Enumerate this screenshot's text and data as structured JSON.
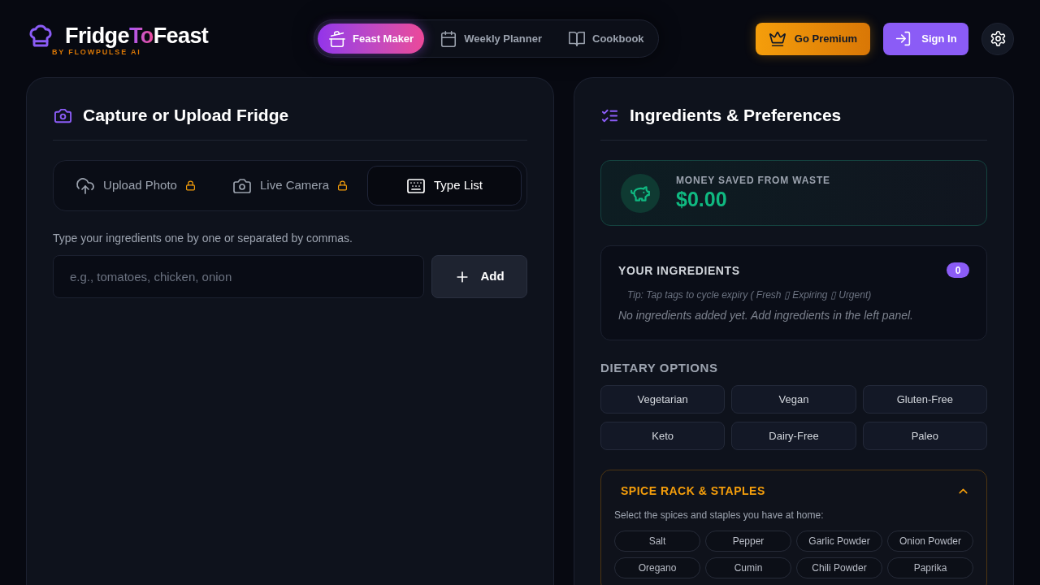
{
  "header": {
    "logo": {
      "title_start": "Fridge",
      "title_accent": "To",
      "title_end": "Feast",
      "tagline": "BY FLOWPULSE AI"
    },
    "nav_tabs": [
      {
        "label": "Feast Maker",
        "selected": true
      },
      {
        "label": "Weekly Planner",
        "selected": false
      },
      {
        "label": "Cookbook",
        "selected": false
      }
    ],
    "actions": [
      {
        "kind": "premium",
        "label": "Go Premium"
      },
      {
        "kind": "signin",
        "label": "Sign In"
      },
      {
        "kind": "settings"
      }
    ]
  },
  "capture_panel": {
    "title": "Capture or Upload Fridge",
    "mode_tabs": [
      {
        "label": "Upload Photo",
        "locked": true,
        "selected": false
      },
      {
        "label": "Live Camera",
        "locked": true,
        "selected": false
      },
      {
        "label": "Type List",
        "locked": false,
        "selected": true
      }
    ],
    "hint": "Type your ingredients one by one or separated by commas.",
    "input": {
      "placeholder": "e.g., tomatoes, chicken, onion"
    },
    "add_button": "Add"
  },
  "preferences_panel": {
    "title": "Ingredients & Preferences",
    "savings": {
      "label": "MONEY SAVED FROM WASTE",
      "amount": "$0.00"
    },
    "ingredients": {
      "title": "YOUR INGREDIENTS",
      "count": "0",
      "tip": "Tip: Tap tags to cycle expiry ( Fresh ▯ Expiring ▯ Urgent)",
      "empty_message": "No ingredients added yet. Add ingredients in the left panel."
    },
    "dietary": {
      "title": "DIETARY OPTIONS",
      "options": [
        {
          "label": "Vegetarian",
          "selected": false
        },
        {
          "label": "Vegan",
          "selected": false
        },
        {
          "label": "Gluten-Free",
          "selected": false
        },
        {
          "label": "Keto",
          "selected": false
        },
        {
          "label": "Dairy-Free",
          "selected": false
        },
        {
          "label": "Paleo",
          "selected": false
        }
      ]
    },
    "spice_rack": {
      "title": "SPICE RACK & STAPLES",
      "expanded": true,
      "hint": "Select the spices and staples you have at home:",
      "items": [
        {
          "label": "Salt",
          "selected": false
        },
        {
          "label": "Pepper",
          "selected": false
        },
        {
          "label": "Garlic Powder",
          "selected": false
        },
        {
          "label": "Onion Powder",
          "selected": false
        },
        {
          "label": "Oregano",
          "selected": false
        },
        {
          "label": "Cumin",
          "selected": false
        },
        {
          "label": "Chili Powder",
          "selected": false
        },
        {
          "label": "Paprika",
          "selected": false
        }
      ]
    }
  }
}
